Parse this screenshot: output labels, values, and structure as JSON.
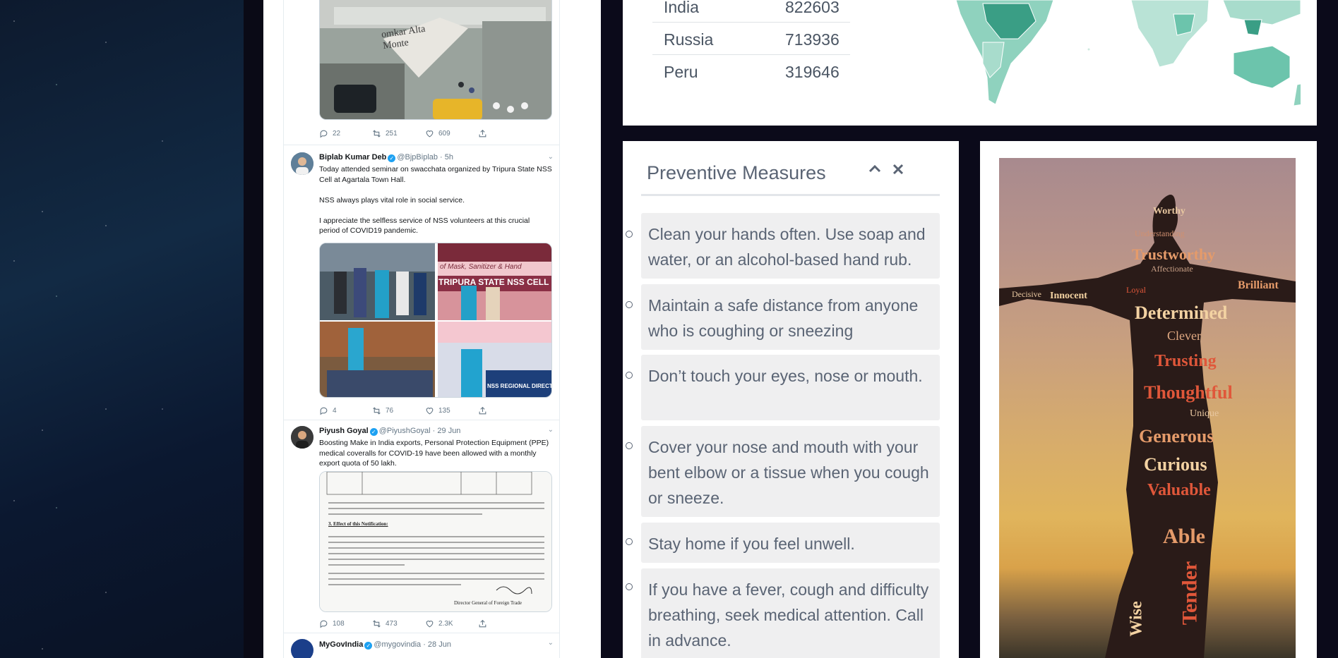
{
  "tweets": [
    {
      "id": "omkar",
      "media_caption": "omkar Alta Monte",
      "replies": "22",
      "retweets": "251",
      "likes": "609"
    },
    {
      "id": "biplab",
      "name": "Biplab Kumar Deb",
      "handle": "@BjpBiplab · 5h",
      "text": "Today attended seminar on swacchata organized by Tripura State NSS Cell at Agartala Town Hall.\n\nNSS always plays vital role in social service.\n\nI appreciate the selfless service of NSS volunteers at this crucial period of COVID19 pandemic.",
      "media_labels": [
        "TRIPURA STATE NSS CELL",
        "of Mask, Sanitizer & Hand",
        "NSS REGIONAL DIRECTORA"
      ],
      "replies": "4",
      "retweets": "76",
      "likes": "135"
    },
    {
      "id": "piyush",
      "name": "Piyush Goyal",
      "handle": "@PiyushGoyal · 29 Jun",
      "text": "Boosting Make in India exports, Personal Protection Equipment (PPE) medical coveralls for COVID-19 have been allowed with a monthly export quota of 50 lakh.",
      "doc_heading": "3. Effect of this Notification:",
      "doc_footer": "Director General of Foreign Trade",
      "replies": "108",
      "retweets": "473",
      "likes": "2.3K"
    },
    {
      "id": "mygov",
      "name": "MyGovIndia",
      "handle": "@mygovindia · 28 Jun"
    }
  ],
  "countries": [
    {
      "name": "India",
      "value": "822603"
    },
    {
      "name": "Russia",
      "value": "713936"
    },
    {
      "name": "Peru",
      "value": "319646"
    }
  ],
  "preventive": {
    "title": "Preventive Measures",
    "collapse_icon": "chevron-up-icon",
    "close_icon": "close-icon",
    "items": [
      "Clean your hands often. Use soap and water, or an alcohol-based hand rub.",
      "Maintain a safe distance from anyone who is coughing or sneezing",
      "Don’t touch your eyes, nose or mouth.",
      "Cover your nose and mouth with your bent elbow or a tissue when you cough or sneeze.",
      "Stay home if you feel unwell.",
      "If you have a fever, cough and difficulty breathing, seek medical attention. Call in advance."
    ]
  },
  "word_cloud": [
    "Worthy",
    "Understanding",
    "Trustworthy",
    "Affectionate",
    "Determined",
    "Clever",
    "Trusting",
    "Thoughtful",
    "Unique",
    "Generous",
    "Curious",
    "Valuable",
    "Able",
    "Tender",
    "Wise",
    "Decisive",
    "Innocent",
    "Brilliant",
    "Loyal"
  ],
  "colors": {
    "map_fill": "#6cc4ac",
    "map_dark": "#3a9e85",
    "text_gray": "#5a6474",
    "item_bg": "#efeff0"
  }
}
